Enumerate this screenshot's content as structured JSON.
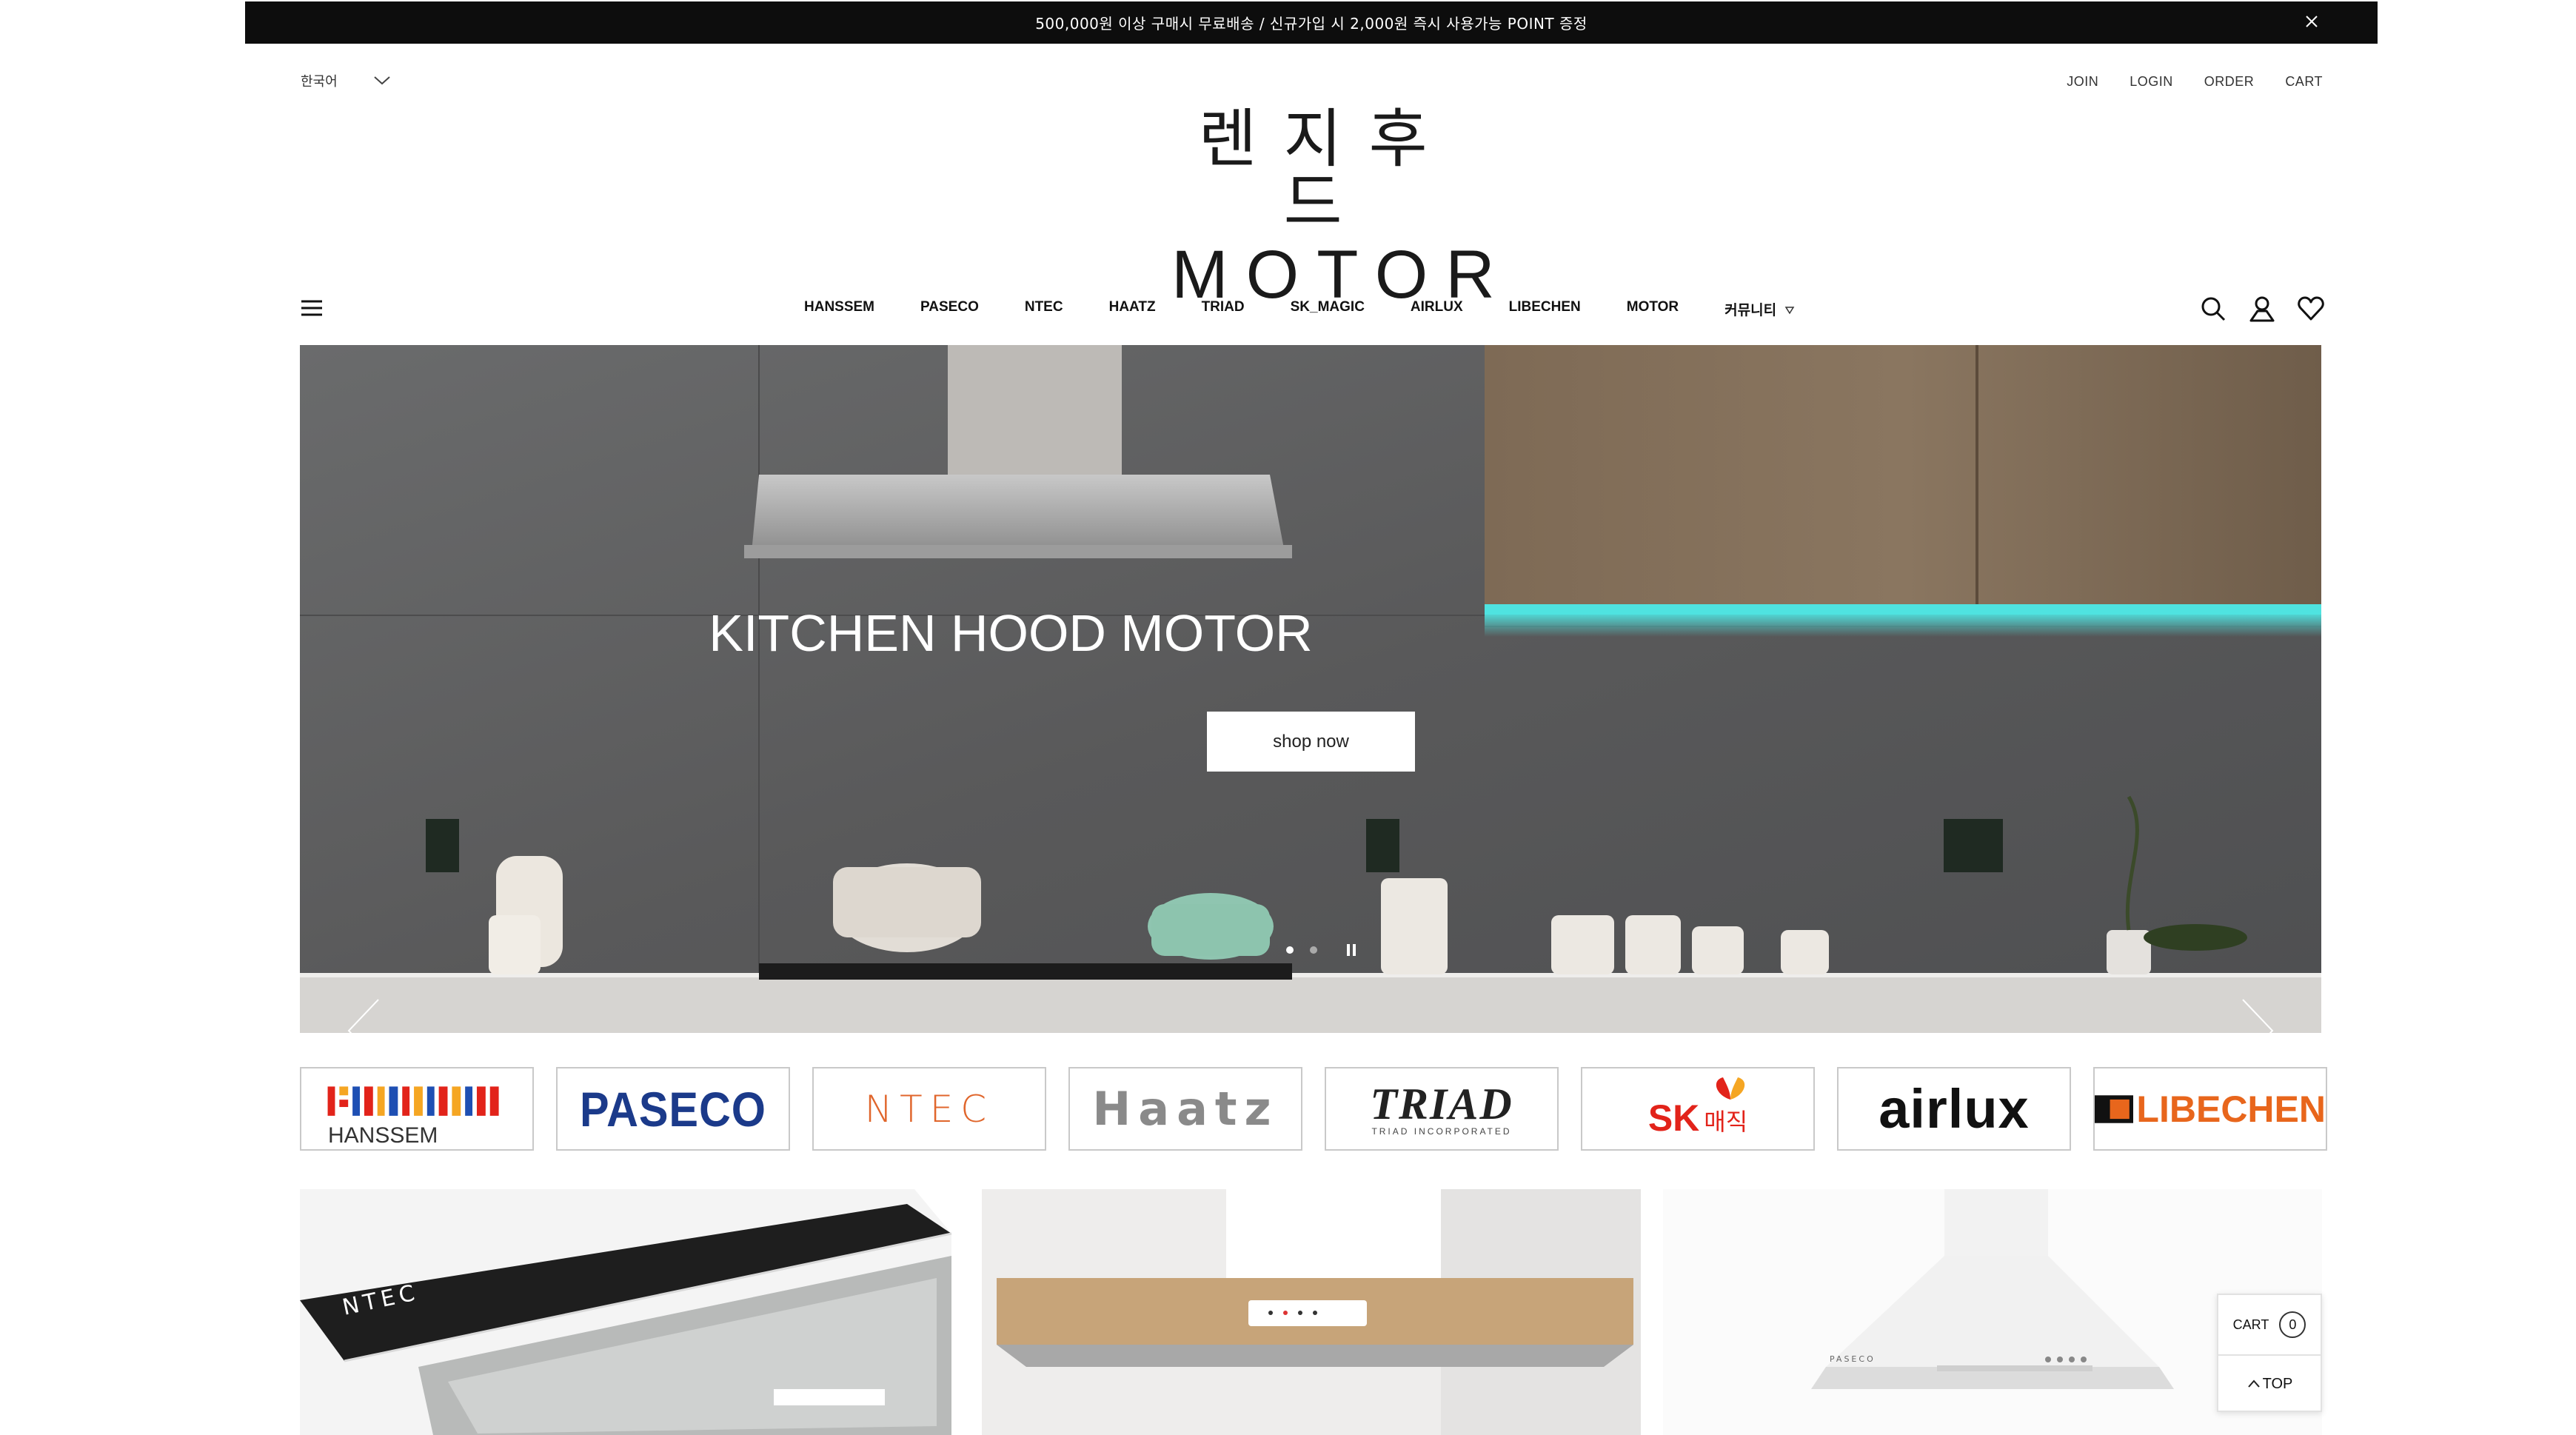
{
  "announcement": {
    "text": "500,000원 이상 구매시 무료배송 / 신규가입 시 2,000원 즉시 사용가능 POINT 증정"
  },
  "header": {
    "language": "한국어",
    "util_links": [
      "JOIN",
      "LOGIN",
      "ORDER",
      "CART"
    ],
    "logo_korean": "렌지후드",
    "logo_english": "MOTOR"
  },
  "nav": {
    "items": [
      "HANSSEM",
      "PASECO",
      "NTEC",
      "HAATZ",
      "TRIAD",
      "SK_MAGIC",
      "AIRLUX",
      "LIBECHEN",
      "MOTOR",
      "커뮤니티"
    ],
    "icons": [
      "search-icon",
      "user-icon",
      "heart-icon"
    ]
  },
  "hero": {
    "title": "KITCHEN HOOD MOTOR",
    "button_label": "shop now",
    "slide_count": 2,
    "active_slide": 1
  },
  "brands": {
    "hanssem": "HANSSEM",
    "paseco": "PASECO",
    "ntec": "NTEC",
    "haatz": "Haatz",
    "triad": "TRIAD",
    "triad_sub": "TRIAD INCORPORATED",
    "sk_a": "SK",
    "sk_b": "매직",
    "airlux": "airlux",
    "libechen": "LIBECHEN"
  },
  "products": {
    "ntec_label": "NTEC",
    "paseco_label": "PASECO"
  },
  "floating": {
    "cart_label": "CART",
    "cart_count": "0",
    "top_label": "TOP"
  },
  "colors": {
    "announcement_bg": "#0d0d0d",
    "hero_teal_glow": "#4fe3e0",
    "paseco_blue": "#1b3a8a",
    "ntec_orange": "#e0662c",
    "libechen_orange": "#e8661c",
    "sk_red": "#e2231a"
  }
}
